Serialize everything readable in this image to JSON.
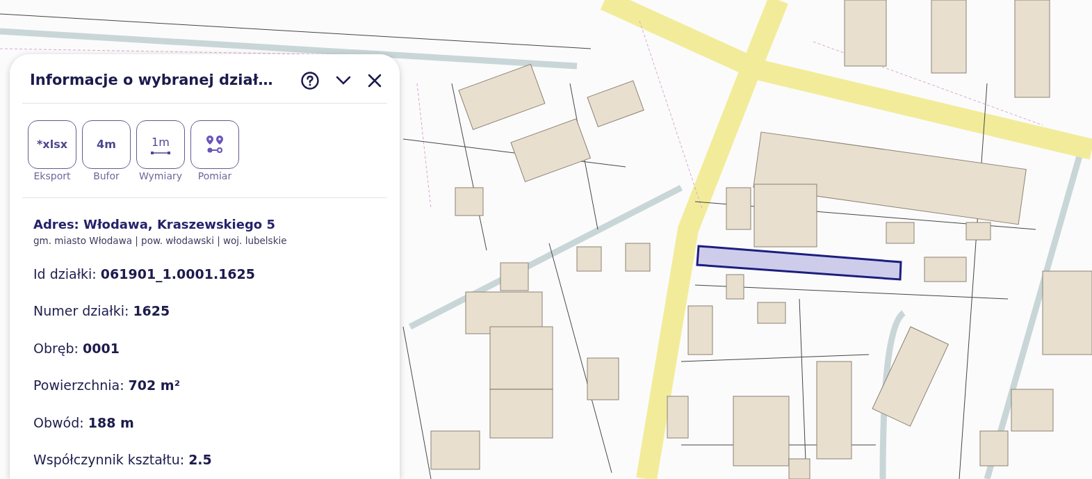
{
  "panel": {
    "title": "Informacje o wybranej dział…",
    "tools": [
      {
        "kind": "text",
        "value": "*xlsx",
        "label": "Eksport"
      },
      {
        "kind": "text",
        "value": "4m",
        "label": "Bufor"
      },
      {
        "kind": "ruler",
        "value": "1m",
        "label": "Wymiary"
      },
      {
        "kind": "pins",
        "label": "Pomiar"
      }
    ],
    "address": "Adres: Włodawa, Kraszewskiego 5",
    "region": "gm. miasto Włodawa | pow. włodawski | woj. lubelskie",
    "details": [
      "Id działki: **061901_1.0001.1625**",
      "Numer działki: **1625**",
      "Obręb: **0001**",
      "Powierzchnia: **702 m²**",
      "Obwód: **188 m**",
      "Współczynnik kształtu: **2.5**"
    ]
  }
}
